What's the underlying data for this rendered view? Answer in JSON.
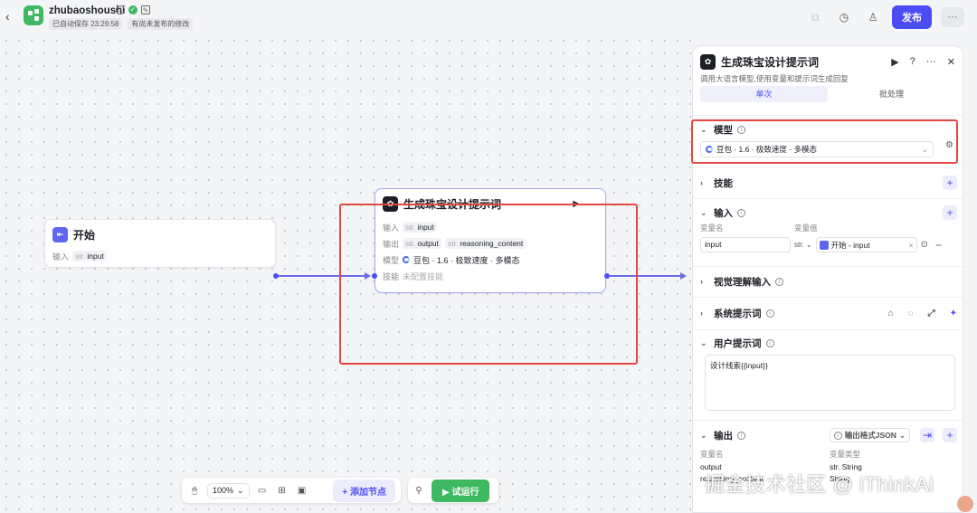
{
  "app": {
    "name": "zhubaoshoushi",
    "autosave": "已自动保存 23:29:58",
    "unpublished": "有尚未发布的修改",
    "publish_label": "发布",
    "more_label": "···"
  },
  "canvas": {
    "start_node": {
      "title": "开始",
      "input_label": "输入",
      "input_type": "str.",
      "input_name": "input"
    },
    "llm_node": {
      "title": "生成珠宝设计提示词",
      "input_label": "输入",
      "input_type": "str.",
      "input_name": "input",
      "output_label": "输出",
      "output1_type": "str.",
      "output1": "output",
      "output2_type": "str.",
      "output2": "reasoning_content",
      "model_label": "模型",
      "model": "豆包 · 1.6 · 极致速度 · 多模态",
      "skills_label": "技能",
      "skills_value": "未配置技能"
    }
  },
  "toolbar": {
    "zoom": "100%",
    "add_node": "添加节点",
    "run": "试运行"
  },
  "panel": {
    "title": "生成珠宝设计提示词",
    "description": "调用大语言模型,使用变量和提示词生成回复",
    "tabs": [
      "单次",
      "批处理"
    ],
    "model_section": "模型",
    "model_value": "豆包 · 1.6 · 极致速度 · 多模态",
    "skills_section": "技能",
    "input_section": "输入",
    "col_var_name": "变量名",
    "col_var_value": "变量值",
    "input_name": "input",
    "input_type": "str.",
    "input_ref": "开始 - input",
    "vision_section": "视觉理解输入",
    "system_prompt_section": "系统提示词",
    "user_prompt_section": "用户提示词",
    "user_prompt_text": "设计线索{{input}}",
    "output_section": "输出",
    "output_format": "输出格式JSON",
    "col_out_name": "变量名",
    "col_out_type": "变量类型",
    "out1_name": "output",
    "out1_type": "str. String",
    "out2_name": "reasoning_content",
    "out2_type": "String"
  },
  "watermark": "掘金技术社区 @ iThinkAi",
  "colors": {
    "accent": "#4c4cf5",
    "green": "#3fb862",
    "highlight": "#e2483f"
  }
}
